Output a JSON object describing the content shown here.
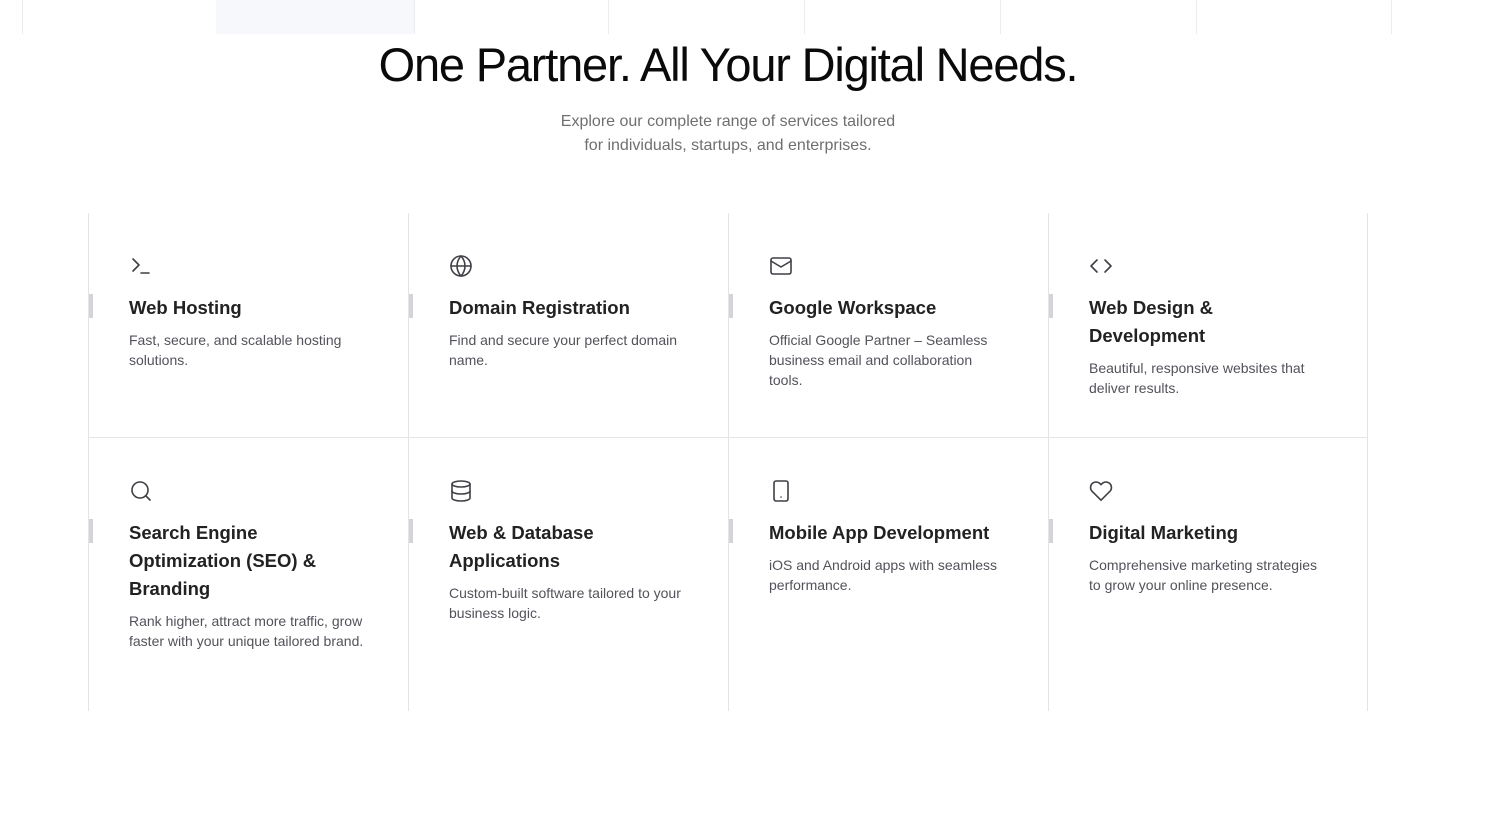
{
  "heading": "One Partner. All Your Digital Needs.",
  "subtitle": {
    "line1": "Explore our complete range of services tailored",
    "line2": "for individuals, startups, and enterprises."
  },
  "services": [
    {
      "icon": "terminal-icon",
      "title": "Web Hosting",
      "description": "Fast, secure, and scalable hosting solutions."
    },
    {
      "icon": "globe-icon",
      "title": "Domain Registration",
      "description": "Find and secure your perfect domain name."
    },
    {
      "icon": "mail-icon",
      "title": "Google Workspace",
      "description": "Official Google Partner – Seamless business email and collaboration tools."
    },
    {
      "icon": "code-icon",
      "title": "Web Design & Development",
      "description": "Beautiful, responsive websites that deliver results."
    },
    {
      "icon": "search-icon",
      "title": "Search Engine Optimization (SEO) & Branding",
      "description": "Rank higher, attract more traffic, grow faster with your unique tailored brand."
    },
    {
      "icon": "database-icon",
      "title": "Web & Database Applications",
      "description": "Custom-built software tailored to your business logic."
    },
    {
      "icon": "smartphone-icon",
      "title": "Mobile App Development",
      "description": "iOS and Android apps with seamless performance."
    },
    {
      "icon": "heart-icon",
      "title": "Digital Marketing",
      "description": "Comprehensive marketing strategies to grow your online presence."
    }
  ]
}
